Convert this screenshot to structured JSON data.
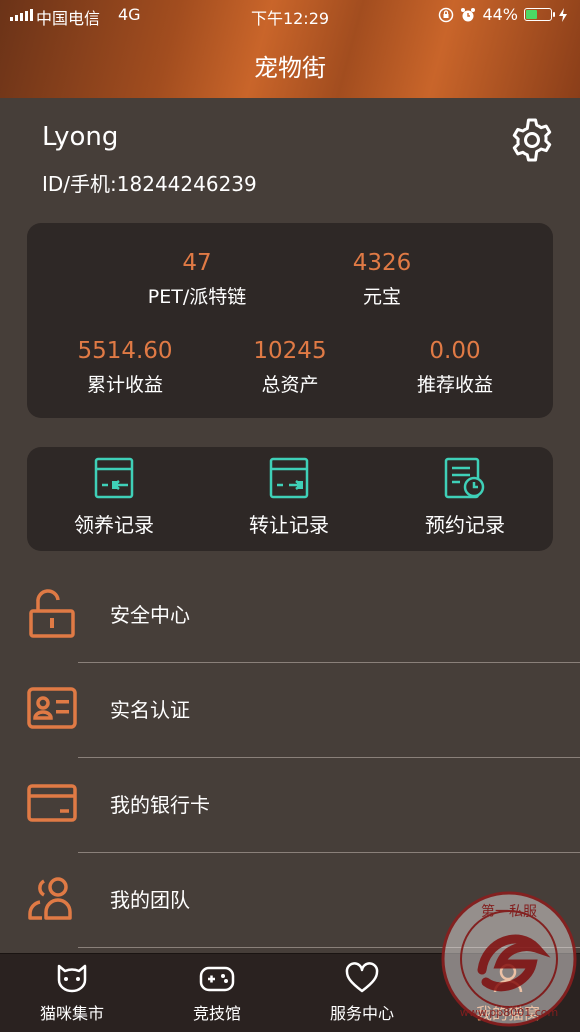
{
  "status_bar": {
    "carrier": "中国电信",
    "network": "4G",
    "time": "下午12:29",
    "battery": "44%",
    "battery_level": 0.44
  },
  "header": {
    "title": "宠物街"
  },
  "profile": {
    "name": "Lyong",
    "id_line": "ID/手机:18244246239"
  },
  "stats": {
    "pet": {
      "value": "47",
      "label": "PET/派特链"
    },
    "yuanbao": {
      "value": "4326",
      "label": "元宝"
    },
    "cumulative": {
      "value": "5514.60",
      "label": "累计收益"
    },
    "total_assets": {
      "value": "10245",
      "label": "总资产"
    },
    "referral": {
      "value": "0.00",
      "label": "推荐收益"
    }
  },
  "records": [
    {
      "label": "领养记录",
      "icon": "adopt-record-icon"
    },
    {
      "label": "转让记录",
      "icon": "transfer-record-icon"
    },
    {
      "label": "预约记录",
      "icon": "reservation-record-icon"
    }
  ],
  "menu": [
    {
      "label": "安全中心",
      "icon": "unlock-icon"
    },
    {
      "label": "实名认证",
      "icon": "id-card-icon"
    },
    {
      "label": "我的银行卡",
      "icon": "bank-card-icon"
    },
    {
      "label": "我的团队",
      "icon": "team-icon"
    }
  ],
  "tabbar": [
    {
      "label": "猫咪集市",
      "icon": "cat-icon"
    },
    {
      "label": "竞技馆",
      "icon": "gamepad-icon"
    },
    {
      "label": "服务中心",
      "icon": "heart-icon"
    },
    {
      "label": "我的猫窝",
      "icon": "user-icon"
    }
  ],
  "watermark": {
    "text": "www.pp8001.com",
    "seal_text": "第一私服"
  },
  "colors": {
    "accent": "#e07a45",
    "teal": "#3fd0b8",
    "background": "#463e39",
    "card": "#2e2826"
  }
}
